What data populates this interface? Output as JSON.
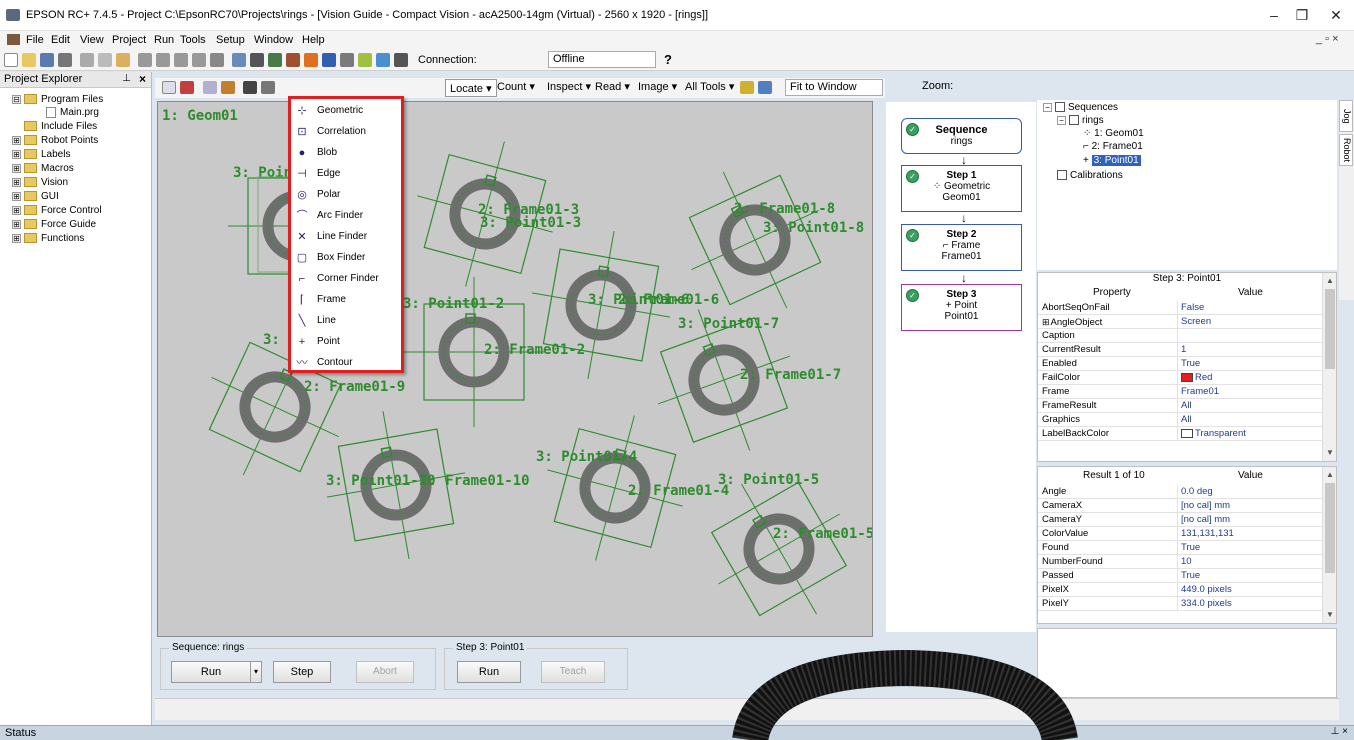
{
  "window": {
    "title": "EPSON RC+ 7.4.5 - Project C:\\EpsonRC70\\Projects\\rings - [Vision Guide - Compact Vision - acA2500-14gm (Virtual) - 2560 x 1920 - [rings]]",
    "minimize": "–",
    "restore": "❐",
    "close": "✕"
  },
  "menu": {
    "items": [
      "File",
      "Edit",
      "View",
      "Project",
      "Run",
      "Tools",
      "Setup",
      "Window",
      "Help"
    ],
    "mdi_controls": "_ ▫ ×"
  },
  "toolbar": {
    "connection_label": "Connection:",
    "connection_value": "Offline",
    "help_label": "?"
  },
  "project_explorer": {
    "title": "Project Explorer",
    "pin": "⊥",
    "close": "×",
    "items": [
      {
        "label": "Program Files",
        "expander": "⊟"
      },
      {
        "label": "Main.prg",
        "expander": ""
      },
      {
        "label": "Include Files",
        "expander": ""
      },
      {
        "label": "Robot Points",
        "expander": "⊞"
      },
      {
        "label": "Labels",
        "expander": "⊞"
      },
      {
        "label": "Macros",
        "expander": "⊞"
      },
      {
        "label": "Vision",
        "expander": "⊞"
      },
      {
        "label": "GUI",
        "expander": "⊞"
      },
      {
        "label": "Force Control",
        "expander": "⊞"
      },
      {
        "label": "Force Guide",
        "expander": "⊞"
      },
      {
        "label": "Functions",
        "expander": "⊞"
      }
    ]
  },
  "vision_toolbar": {
    "locate": "Locate ▾",
    "count": "Count ▾",
    "inspect": "Inspect ▾",
    "read": "Read ▾",
    "image": "Image ▾",
    "all_tools": "All Tools ▾",
    "zoom_label": "Zoom:",
    "zoom_value": "Fit to Window"
  },
  "locate_menu": {
    "items": [
      "Geometric",
      "Correlation",
      "Blob",
      "Edge",
      "Polar",
      "Arc Finder",
      "Line Finder",
      "Box Finder",
      "Corner Finder",
      "Frame",
      "Line",
      "Point",
      "Contour"
    ],
    "icons": [
      "⊹",
      "⊡",
      "●",
      "⊣",
      "◎",
      "⌒",
      "✕",
      "▢",
      "⌐",
      "⌈",
      "╲",
      "+",
      "〰"
    ]
  },
  "image_overlay": {
    "geom_label": "1: Geom01",
    "labels": [
      "3: Poin",
      "1",
      "2: Frame01-3",
      "3: Point01-3",
      "2: Frame01-8",
      "3: Point01-8",
      "3: Point01-6",
      "2: Frame01-6",
      "3: Point01-2",
      "3: Point01-7",
      "2: Frame01-2",
      "3:",
      "2: Frame01-9",
      "2: Frame01-7",
      "3: Point01-4",
      "3: Point01-10",
      "2: Frame01-10",
      "2: Frame01-4",
      "3: Point01-5",
      "2: Frame01-5"
    ],
    "ring_color": "#6e6e6e",
    "overlay_color": "#2e8b2e"
  },
  "sequence_panel": {
    "group_label": "Sequence: rings",
    "run": "Run",
    "step": "Step",
    "abort": "Abort",
    "dropdown": "▾"
  },
  "step_panel": {
    "group_label": "Step 3: Point01",
    "run": "Run",
    "teach": "Teach"
  },
  "flow": {
    "sequence": {
      "title": "Sequence",
      "name": "rings"
    },
    "steps": [
      {
        "title": "Step 1",
        "icon": "⁘",
        "type": "Geometric",
        "name": "Geom01"
      },
      {
        "title": "Step 2",
        "icon": "⌐",
        "type": "Frame",
        "name": "Frame01"
      },
      {
        "title": "Step 3",
        "icon": "+",
        "type": "Point",
        "name": "Point01"
      }
    ],
    "arrow": "↓",
    "check": "✓"
  },
  "sequence_tree": {
    "root": "Sequences",
    "sequence": "rings",
    "children": [
      "1: Geom01",
      "2: Frame01",
      "3: Point01"
    ],
    "calibrations": "Calibrations"
  },
  "side_tabs": [
    "Jog",
    "Robot"
  ],
  "properties": {
    "title": "Step 3: Point01",
    "col_property": "Property",
    "col_value": "Value",
    "rows": [
      {
        "k": "AbortSeqOnFail",
        "v": "False"
      },
      {
        "k": "AngleObject",
        "v": "Screen"
      },
      {
        "k": "Caption",
        "v": ""
      },
      {
        "k": "CurrentResult",
        "v": "1"
      },
      {
        "k": "Enabled",
        "v": "True"
      },
      {
        "k": "FailColor",
        "v": "Red"
      },
      {
        "k": "Frame",
        "v": "Frame01"
      },
      {
        "k": "FrameResult",
        "v": "All"
      },
      {
        "k": "Graphics",
        "v": "All"
      },
      {
        "k": "LabelBackColor",
        "v": "Transparent"
      }
    ],
    "expander": "⊞",
    "fail_color_swatch": "#e02020"
  },
  "results": {
    "title": "Result 1 of 10",
    "col_value": "Value",
    "rows": [
      {
        "k": "Angle",
        "v": "0.0 deg"
      },
      {
        "k": "CameraX",
        "v": "[no cal] mm"
      },
      {
        "k": "CameraY",
        "v": "[no cal] mm"
      },
      {
        "k": "ColorValue",
        "v": "131,131,131"
      },
      {
        "k": "Found",
        "v": "True"
      },
      {
        "k": "NumberFound",
        "v": "10"
      },
      {
        "k": "Passed",
        "v": "True"
      },
      {
        "k": "PixelX",
        "v": "449.0 pixels"
      },
      {
        "k": "PixelY",
        "v": "334.0 pixels"
      }
    ]
  },
  "status": {
    "label": "Status",
    "controls": "⊥ ×"
  }
}
